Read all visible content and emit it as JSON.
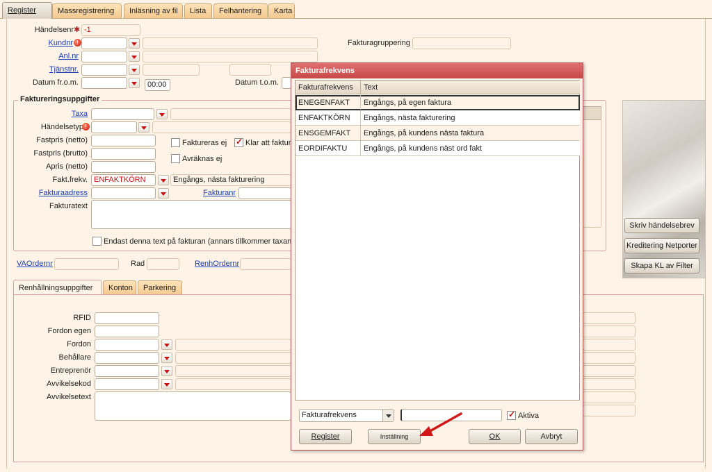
{
  "tabs": [
    {
      "label": "Register"
    },
    {
      "label": "Massregistrering"
    },
    {
      "label": "Inläsning av fil"
    },
    {
      "label": "Lista"
    },
    {
      "label": "Felhantering"
    },
    {
      "label": "Karta"
    }
  ],
  "header": {
    "handelsenr_label": "Händelsenr",
    "handelsenr_value": "-1",
    "kundnr_label": "Kundnr",
    "anlnr_label": "Anl.nr",
    "tjanstnr_label": "Tjänstnr.",
    "datum_from_label": "Datum fr.o.m.",
    "datum_from_time": "00:00",
    "datum_tom_label": "Datum t.o.m.",
    "fakturagruppering_label": "Fakturagruppering"
  },
  "fakturering": {
    "title": "Faktureringsuppgifter",
    "taxa_label": "Taxa",
    "handelsetyp_label": "Händelsetyp",
    "fastpris_netto_label": "Fastpris (netto)",
    "fastpris_brutto_label": "Fastpris (brutto)",
    "apris_netto_label": "Apris (netto)",
    "faktfrekv_label": "Fakt.frekv.",
    "faktfrekv_value": "ENFAKTKÖRN",
    "faktfrekv_text": "Engångs, nästa fakturering",
    "fakturaadress_label": "Fakturaadress",
    "fakturanr_label": "Fakturanr",
    "fakturatext_label": "Fakturatext",
    "faktureras_ej_label": "Faktureras ej",
    "klar_att_fakturera_label": "Klar att faktur",
    "avraknas_ej_label": "Avräknas ej",
    "endast_text_label": "Endast denna text på fakturan (annars tillkommer taxans"
  },
  "order": {
    "vaordernr_label": "VAOrdernr",
    "rad_label": "Rad",
    "renhordernr_label": "RenhOrdernr"
  },
  "side_buttons": {
    "skriv": "Skriv händelsebrev",
    "kreditering": "Kreditering Netporter",
    "skapa": "Skapa KL av Filter"
  },
  "subtabs": [
    {
      "label": "Renhållningsuppgifter"
    },
    {
      "label": "Konton"
    },
    {
      "label": "Parkering"
    }
  ],
  "renhallning": {
    "rfid_label": "RFID",
    "fordon_egen_label": "Fordon egen",
    "fordon_label": "Fordon",
    "behallare_label": "Behållare",
    "entreprenor_label": "Entreprenör",
    "avvikelsekod_label": "Avvikelsekod",
    "avvikelsetext_label": "Avvikelsetext"
  },
  "dialog": {
    "title": "Fakturafrekvens",
    "columns": [
      "Fakturafrekvens",
      "Text"
    ],
    "rows": [
      {
        "code": "ENEGENFAKT",
        "text": "Engångs, på egen faktura"
      },
      {
        "code": "ENFAKTKÖRN",
        "text": "Engångs, nästa fakturering"
      },
      {
        "code": "ENSGEMFAKT",
        "text": "Engångs, på kundens nästa faktura"
      },
      {
        "code": "EORDIFAKTU",
        "text": "Engångs, på kundens näst ord fakt"
      }
    ],
    "filter_select": "Fakturafrekvens",
    "filter_value": "",
    "aktiva_label": "Aktiva",
    "register_button": "Register",
    "installning_button": "Inställning",
    "ok_button": "OK",
    "avbryt_button": "Avbryt"
  },
  "colors": {
    "background": "#fdf3e6",
    "accent_red": "#c81010",
    "dialog_title": "#c84848",
    "link": "#1a3cbb"
  }
}
